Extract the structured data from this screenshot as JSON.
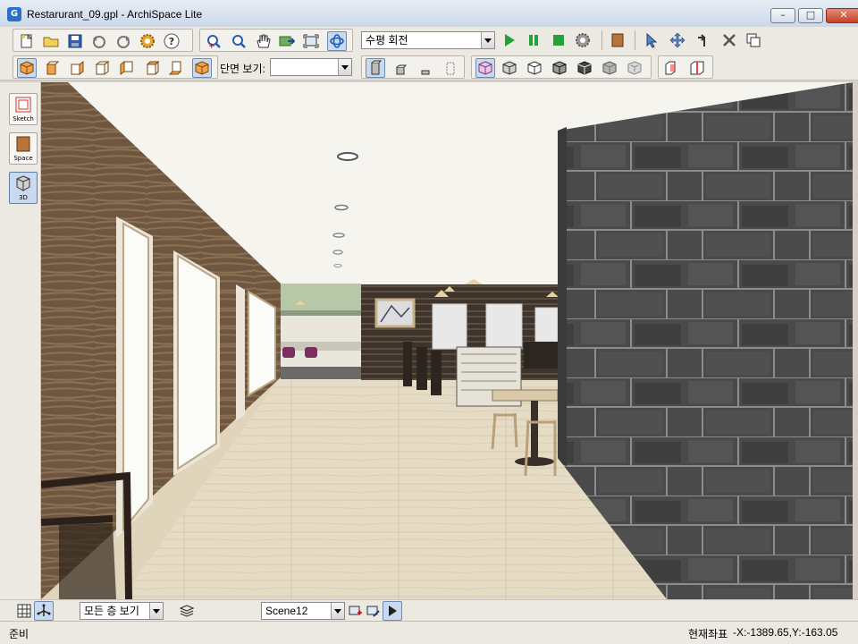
{
  "window": {
    "title": "Restarurant_09.gpl - ArchiSpace Lite",
    "app_icon": "archispace-logo-icon",
    "controls": [
      "minimize-icon",
      "maximize-icon",
      "close-icon"
    ]
  },
  "toolbar_top": {
    "file_buttons": [
      "new-file-icon",
      "open-folder-icon",
      "save-icon",
      "undo-icon",
      "redo-icon",
      "settings-gear-icon",
      "help-icon"
    ],
    "view_buttons": [
      "zoom-in-icon",
      "zoom-out-icon",
      "pan-hand-icon",
      "export-image-icon",
      "fit-view-icon",
      "orbit-icon"
    ],
    "animation_select": {
      "value": "수평 회전"
    },
    "playback_buttons": [
      "play-icon",
      "pause-icon",
      "stop-icon",
      "animation-settings-icon"
    ],
    "material_button": "material-icon",
    "edit_buttons": [
      "select-arrow-icon",
      "move-icon",
      "rotate-icon",
      "delete-icon",
      "copy-icon"
    ]
  },
  "toolbar_second": {
    "view_cube_buttons": [
      "view-iso-icon",
      "view-front-icon",
      "view-right-icon",
      "view-back-icon",
      "view-left-icon",
      "view-top-icon",
      "view-bottom-icon",
      "view-perspective-icon"
    ],
    "section_label": "단면 보기:",
    "section_select": {
      "value": ""
    },
    "wall_buttons": [
      "wall-full-icon",
      "wall-half-icon",
      "wall-low-icon",
      "wall-hidden-icon"
    ],
    "render_buttons": [
      "render-wireframe-icon",
      "render-shaded-icon",
      "render-hidden-line-icon",
      "render-edges-icon",
      "render-texture-icon",
      "render-solid-icon",
      "render-xray-icon"
    ],
    "extra_buttons": [
      "section-box-icon",
      "section-plane-icon"
    ]
  },
  "left_modes": [
    {
      "label": "Sketch",
      "icon": "sketch-icon",
      "active": false
    },
    {
      "label": "Space",
      "icon": "space-icon",
      "active": false
    },
    {
      "label": "3D",
      "icon": "3d-view-icon",
      "active": true
    }
  ],
  "bottom_toolbar": {
    "grid_icon": "grid-icon",
    "snap_icon": "snap-icon",
    "floor_select": {
      "value": "모든 층 보기"
    },
    "layers_icon": "layers-icon",
    "scene_select": {
      "value": "Scene12"
    },
    "scene_buttons": [
      "add-scene-icon",
      "edit-scene-icon",
      "play-scene-icon"
    ]
  },
  "status": {
    "left": "준비",
    "right_label": "현재좌표",
    "coordinates": "-X:-1389.65,Y:-163.05"
  },
  "colors": {
    "wood_wall": "#6e5640",
    "stone_wall": "#4a4a4a",
    "floor": "#e6dcc6",
    "ceiling": "#f6f4ef",
    "accent_blue": "#2b6fc9"
  }
}
